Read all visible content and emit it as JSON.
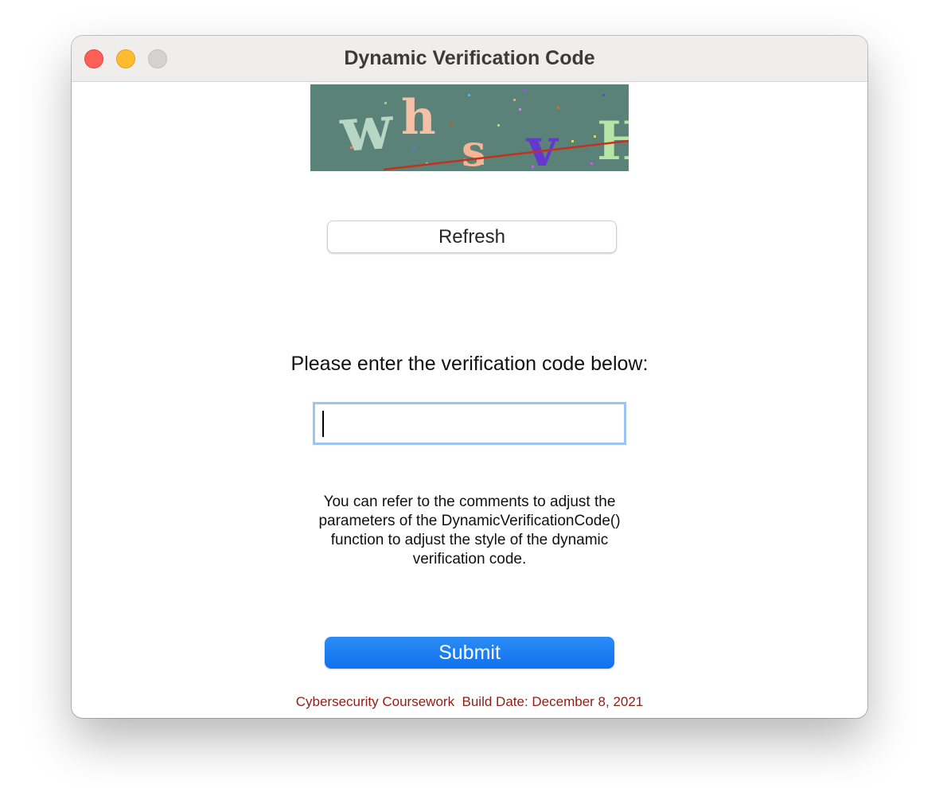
{
  "window": {
    "title": "Dynamic Verification Code"
  },
  "captcha": {
    "letters": [
      "w",
      "h",
      "s",
      "v",
      "H"
    ],
    "background_color": "#5a8279",
    "letter_colors": [
      "#b7d6c4",
      "#f4c1a7",
      "#f6b696",
      "#6437cf",
      "#b7e3a5"
    ],
    "line_color": "#c4321a"
  },
  "refresh_button": {
    "label": "Refresh"
  },
  "prompt": {
    "text": "Please enter the verification code below:"
  },
  "code_input": {
    "value": "",
    "placeholder": ""
  },
  "hint": {
    "line1": "You can refer to the comments to adjust the",
    "line2": "parameters of the DynamicVerificationCode()",
    "line3": "function to adjust the style of the dynamic",
    "line4": "verification code."
  },
  "submit_button": {
    "label": "Submit",
    "color": "#1a7ff2"
  },
  "footer": {
    "text": "Cybersecurity Coursework  Build Date: December 8, 2021",
    "color": "#8f1d14"
  },
  "traffic_lights": {
    "close": "#fe5f57",
    "minimize": "#febc2e",
    "zoom": "#d4d3d2"
  }
}
